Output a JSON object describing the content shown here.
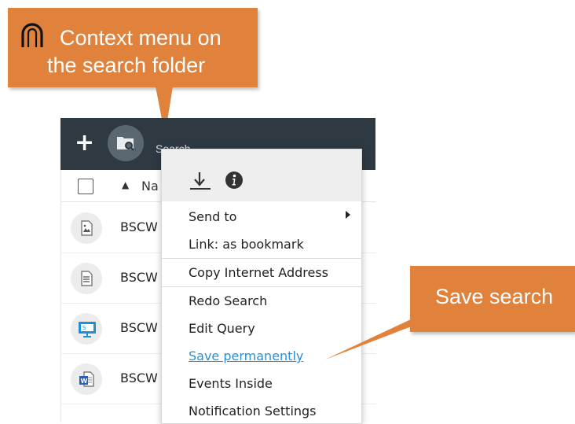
{
  "callouts": {
    "context_menu_line1": "Context menu on",
    "context_menu_line2": "the search folder",
    "save_search": "Save search"
  },
  "toolbar": {
    "add_label": "+",
    "search_label": "Search"
  },
  "list": {
    "column_name": "Na",
    "rows": [
      {
        "name": "BSCW",
        "icon": "image-file-icon"
      },
      {
        "name": "BSCW",
        "icon": "text-document-icon"
      },
      {
        "name": "BSCW",
        "icon": "presentation-icon"
      },
      {
        "name": "BSCW",
        "icon": "word-document-icon"
      }
    ]
  },
  "menu": {
    "items": [
      {
        "label": "Send to"
      },
      {
        "label": "Link: as bookmark"
      },
      {
        "label": "Copy Internet Address"
      },
      {
        "label": "Redo Search"
      },
      {
        "label": "Edit Query"
      },
      {
        "label": "Save permanently"
      },
      {
        "label": "Events Inside"
      },
      {
        "label": "Notification Settings"
      }
    ]
  },
  "colors": {
    "callout": "#e0823b",
    "toolbar": "#2f3942",
    "link": "#2a8fd6"
  }
}
